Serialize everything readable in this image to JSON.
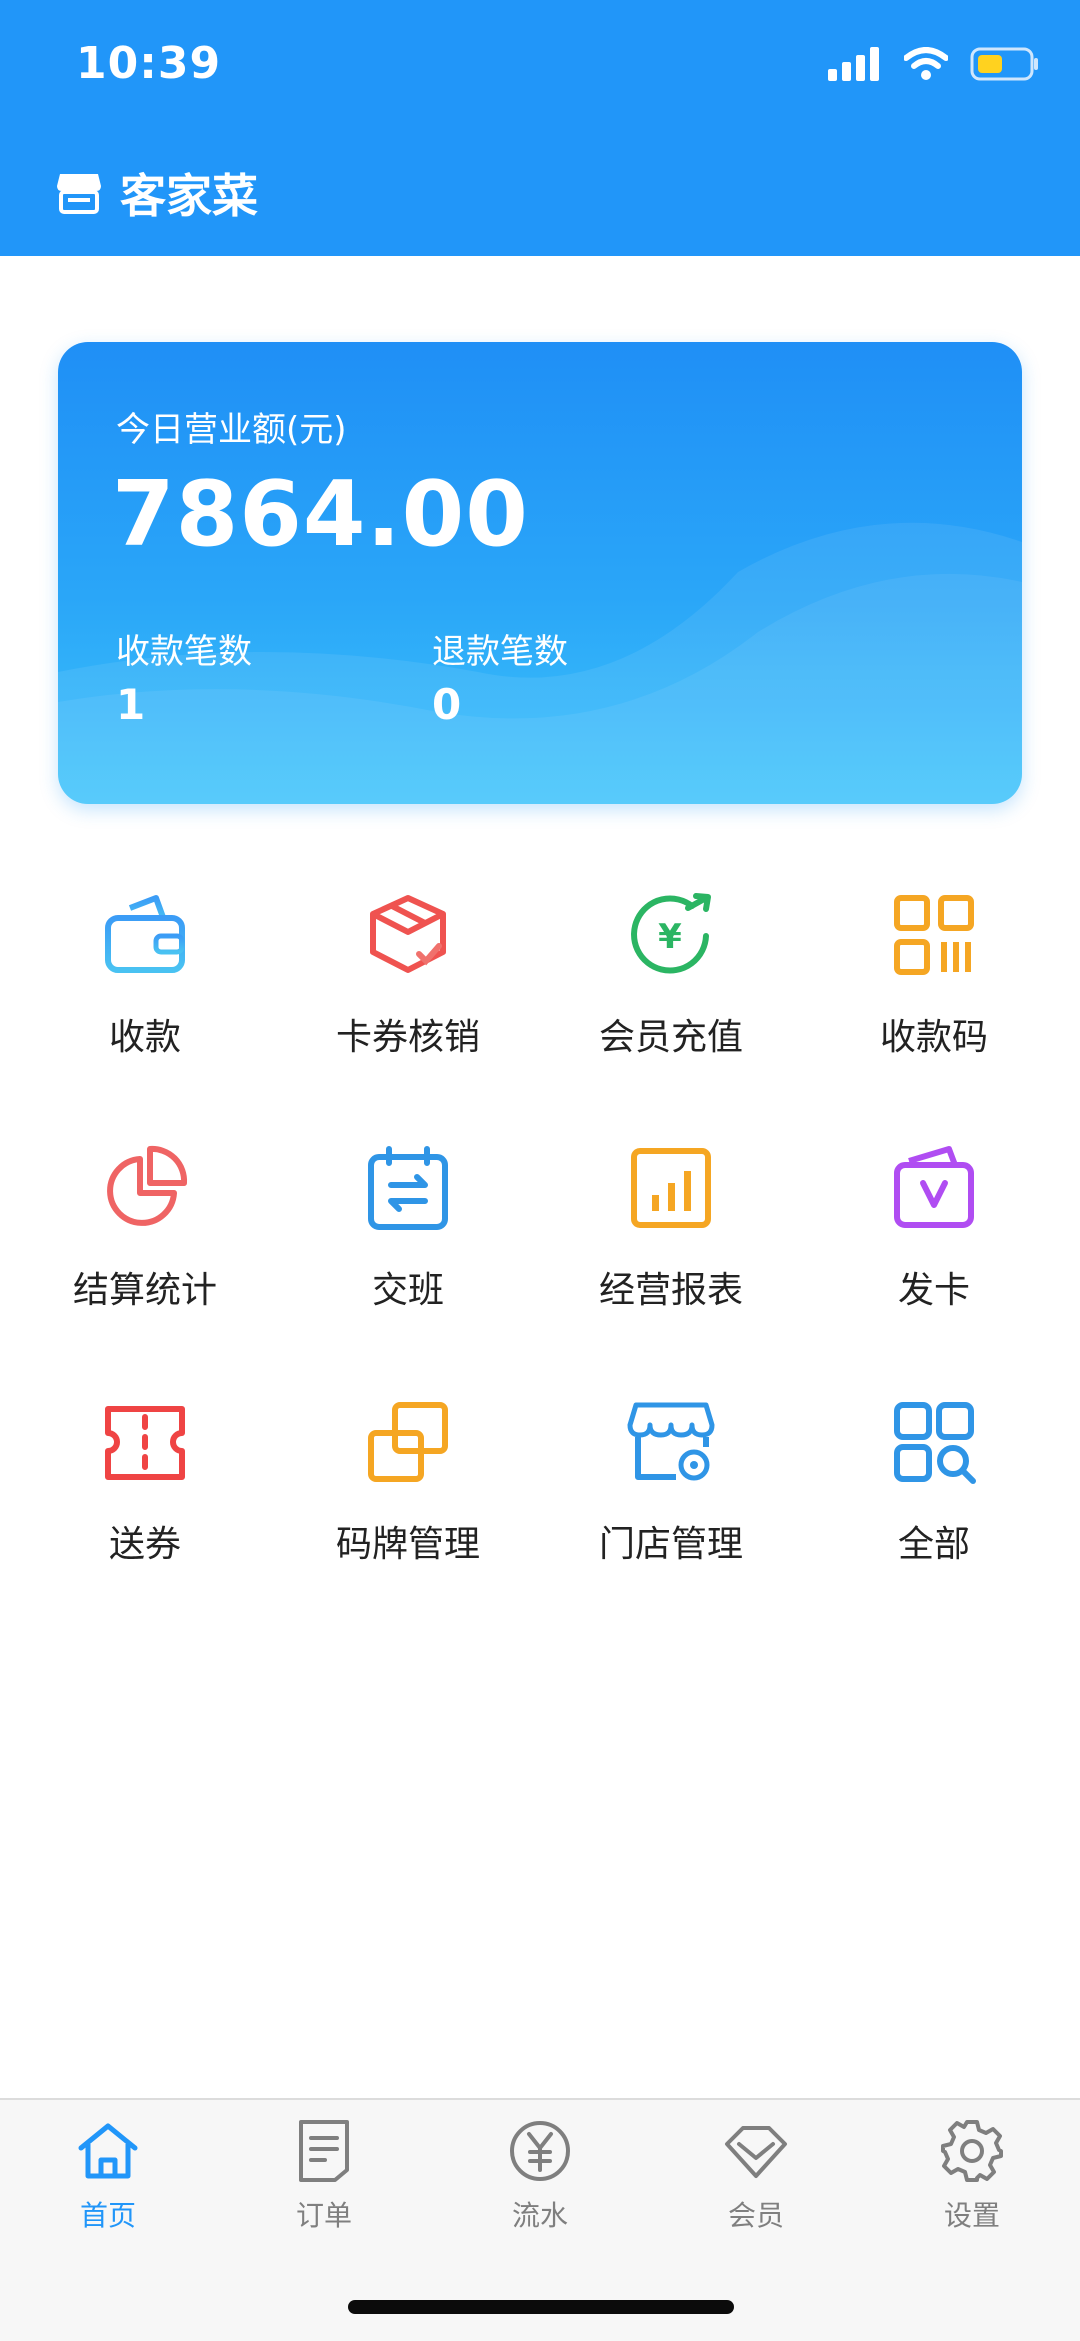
{
  "status_bar": {
    "time": "10:39"
  },
  "header": {
    "title": "客家菜"
  },
  "sales_card": {
    "label": "今日营业额(元)",
    "amount": "7864.00",
    "payments_label": "收款笔数",
    "payments_value": "1",
    "refunds_label": "退款笔数",
    "refunds_value": "0"
  },
  "menu": [
    {
      "label": "收款",
      "icon": "wallet-icon"
    },
    {
      "label": "卡券核销",
      "icon": "coupon-box-icon"
    },
    {
      "label": "会员充值",
      "icon": "yuan-recharge-icon"
    },
    {
      "label": "收款码",
      "icon": "qr-code-icon"
    },
    {
      "label": "结算统计",
      "icon": "pie-chart-icon"
    },
    {
      "label": "交班",
      "icon": "shift-calendar-icon"
    },
    {
      "label": "经营报表",
      "icon": "bar-chart-icon"
    },
    {
      "label": "发卡",
      "icon": "card-icon"
    },
    {
      "label": "送券",
      "icon": "ticket-icon"
    },
    {
      "label": "码牌管理",
      "icon": "code-plate-icon"
    },
    {
      "label": "门店管理",
      "icon": "store-settings-icon"
    },
    {
      "label": "全部",
      "icon": "grid-search-icon"
    }
  ],
  "tabbar": [
    {
      "label": "首页",
      "icon": "home-icon",
      "active": true
    },
    {
      "label": "订单",
      "icon": "order-icon",
      "active": false
    },
    {
      "label": "流水",
      "icon": "yuan-circle-icon",
      "active": false
    },
    {
      "label": "会员",
      "icon": "diamond-icon",
      "active": false
    },
    {
      "label": "设置",
      "icon": "gear-icon",
      "active": false
    }
  ],
  "colors": {
    "primary": "#2196f9",
    "card_bottom": "#3dc3fb",
    "tab_inactive": "#7f7f7f"
  }
}
